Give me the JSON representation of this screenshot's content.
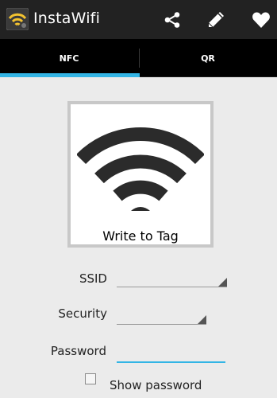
{
  "app": {
    "title": "InstaWifi",
    "accent_color": "#33b5e5",
    "actions": [
      {
        "icon": "share-icon"
      },
      {
        "icon": "pencil-icon"
      },
      {
        "icon": "heart-icon"
      }
    ]
  },
  "tabs": [
    {
      "label": "NFC",
      "selected": true
    },
    {
      "label": "QR",
      "selected": false
    }
  ],
  "main": {
    "tag_button_label": "Write to Tag",
    "tag_button_icon": "wifi-icon",
    "form": {
      "ssid_label": "SSID",
      "ssid_value": "",
      "security_label": "Security",
      "security_value": "",
      "password_label": "Password",
      "password_value": "",
      "show_password_label": "Show password",
      "show_password_checked": false
    }
  }
}
